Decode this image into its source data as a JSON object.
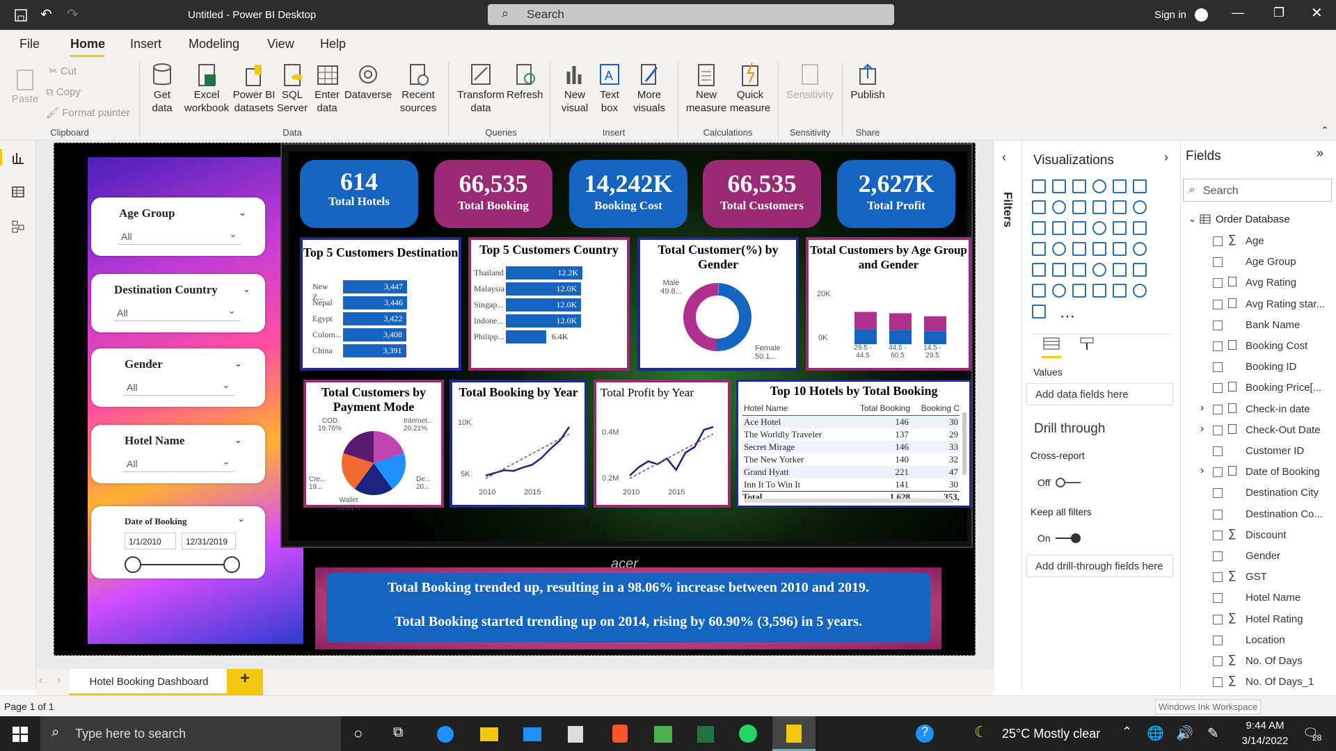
{
  "window": {
    "title": "Untitled - Power BI Desktop",
    "search_placeholder": "Search",
    "sign_in": "Sign in"
  },
  "menu": [
    "File",
    "Home",
    "Insert",
    "Modeling",
    "View",
    "Help"
  ],
  "ribbon": {
    "clipboard": {
      "paste": "Paste",
      "cut": "Cut",
      "copy": "Copy",
      "format_painter": "Format painter",
      "group": "Clipboard"
    },
    "data": {
      "get_data": "Get data",
      "excel": "Excel workbook",
      "pbi": "Power BI datasets",
      "sql": "SQL Server",
      "enter": "Enter data",
      "dataverse": "Dataverse",
      "recent": "Recent sources",
      "group": "Data"
    },
    "queries": {
      "transform": "Transform data",
      "refresh": "Refresh",
      "group": "Queries"
    },
    "insert": {
      "new_visual": "New visual",
      "text_box": "Text box",
      "more": "More visuals",
      "group": "Insert"
    },
    "calc": {
      "new_measure": "New measure",
      "quick_measure": "Quick measure",
      "group": "Calculations"
    },
    "sens": {
      "sensitivity": "Sensitivity",
      "group": "Sensitivity"
    },
    "share": {
      "publish": "Publish",
      "group": "Share"
    }
  },
  "slicers": {
    "age": {
      "label": "Age Group",
      "value": "All"
    },
    "country": {
      "label": "Destination Country",
      "value": "All"
    },
    "gender": {
      "label": "Gender",
      "value": "All"
    },
    "hotel": {
      "label": "Hotel Name",
      "value": "All"
    },
    "date": {
      "label": "Date of Booking",
      "start": "1/1/2010",
      "end": "12/31/2019"
    }
  },
  "kpis": [
    {
      "value": "614",
      "label": "Total Hotels",
      "color": "#1565c0"
    },
    {
      "value": "66,535",
      "label": "Total Booking",
      "color": "#9b2a76"
    },
    {
      "value": "14,242K",
      "label": "Booking Cost",
      "color": "#1565c0"
    },
    {
      "value": "66,535",
      "label": "Total Customers",
      "color": "#9b2a76"
    },
    {
      "value": "2,627K",
      "label": "Total Profit",
      "color": "#1565c0"
    }
  ],
  "chart_data": [
    {
      "type": "bar",
      "title": "Top 5 Customers Destination",
      "categories": [
        "New Z...",
        "Nepal",
        "Egypt",
        "Colom...",
        "China"
      ],
      "values": [
        3447,
        3446,
        3422,
        3408,
        3391
      ],
      "value_labels": [
        "3,447",
        "3,446",
        "3,422",
        "3,408",
        "3,391"
      ]
    },
    {
      "type": "bar",
      "title": "Top 5 Customers Country",
      "categories": [
        "Thailand",
        "Malaysia",
        "Singap...",
        "Indone...",
        "Philipp..."
      ],
      "values": [
        12200,
        12000,
        12000,
        12000,
        6400
      ],
      "value_labels": [
        "12.2K",
        "12.0K",
        "12.0K",
        "12.0K",
        "6.4K"
      ]
    },
    {
      "type": "pie",
      "title": "Total Customer(%) by Gender",
      "labels": [
        "Male 49.8...",
        "Female 50.1..."
      ],
      "values": [
        49.8,
        50.1
      ]
    },
    {
      "type": "bar",
      "title": "Total Customers by Age Group and Gender",
      "categories": [
        "29.5 - 44.5",
        "44.5 - 60.5",
        "14.5 - 29.5"
      ],
      "yticks": [
        "20K",
        "0K"
      ],
      "series": [
        {
          "values": [
            12500,
            12000,
            10800
          ]
        },
        {
          "values": [
            11000,
            10500,
            9500
          ]
        }
      ]
    },
    {
      "type": "pie",
      "title": "Total Customers by Payment Mode",
      "labels": [
        "COD 19.76%",
        "Internet... 20.21%",
        "De... 20...",
        "Wallet 20.01%",
        "Cre... 19..."
      ],
      "values": [
        19.76,
        20.21,
        20.0,
        20.01,
        19.9
      ]
    },
    {
      "type": "line",
      "title": "Total Booking by Year",
      "x": [
        2010,
        2011,
        2012,
        2013,
        2014,
        2015,
        2016,
        2017,
        2018,
        2019
      ],
      "y": [
        5900,
        6100,
        6300,
        6250,
        6500,
        6700,
        7200,
        7900,
        8500,
        9500
      ],
      "yticks": [
        "10K",
        "5K"
      ],
      "xticks": [
        "2010",
        "2015"
      ]
    },
    {
      "type": "line",
      "title": "Total Profit by Year",
      "x": [
        2010,
        2011,
        2012,
        2013,
        2014,
        2015,
        2016,
        2017,
        2018,
        2019
      ],
      "y": [
        0.22,
        0.25,
        0.27,
        0.26,
        0.28,
        0.24,
        0.3,
        0.32,
        0.38,
        0.39
      ],
      "yticks": [
        "0.4M",
        "0.2M"
      ],
      "xticks": [
        "2010",
        "2015"
      ]
    },
    {
      "type": "table",
      "title": "Top 10 Hotels by Total Booking",
      "columns": [
        "Hotel Name",
        "Total Booking",
        "Booking C"
      ],
      "rows": [
        [
          "Ace Hotel",
          "146",
          "30"
        ],
        [
          "The Worldly Traveler",
          "137",
          "29"
        ],
        [
          "Secret Mirage",
          "146",
          "33"
        ],
        [
          "The New Yorker",
          "140",
          "32"
        ],
        [
          "Grand Hyatt",
          "221",
          "47"
        ],
        [
          "Inn It To Win It",
          "141",
          "30"
        ]
      ],
      "total": [
        "Total",
        "1,628",
        "353,"
      ]
    }
  ],
  "insights": [
    "Total Booking trended up, resulting in a 98.06% increase between 2010 and 2019.",
    "Total Booking started trending up on 2014, rising by 60.90% (3,596) in 5 years."
  ],
  "monitor_brand": "acer",
  "filters_label": "Filters",
  "viz": {
    "title": "Visualizations",
    "values": "Values",
    "add_data": "Add data fields here",
    "drill": "Drill through",
    "cross": "Cross-report",
    "cross_state": "Off",
    "keep": "Keep all filters",
    "keep_state": "On",
    "add_drill": "Add drill-through fields here"
  },
  "fields": {
    "title": "Fields",
    "search": "Search",
    "table": "Order Database",
    "items": [
      "Age",
      "Age Group",
      "Avg Rating",
      "Avg Rating star...",
      "Bank Name",
      "Booking Cost",
      "Booking ID",
      "Booking Price[...",
      "Check-in date",
      "Check-Out Date",
      "Customer ID",
      "Date of Booking",
      "Destination City",
      "Destination Co...",
      "Discount",
      "Gender",
      "GST",
      "Hotel Name",
      "Hotel Rating",
      "Location",
      "No. Of Days",
      "No. Of Days_1"
    ]
  },
  "page_tab": "Hotel Booking Dashboard",
  "status": "Page 1 of 1",
  "ink": "Windows Ink Workspace",
  "taskbar": {
    "search": "Type here to search",
    "weather": "25°C  Mostly clear",
    "time": "9:44 AM",
    "date": "3/14/2022",
    "notif": "28"
  }
}
